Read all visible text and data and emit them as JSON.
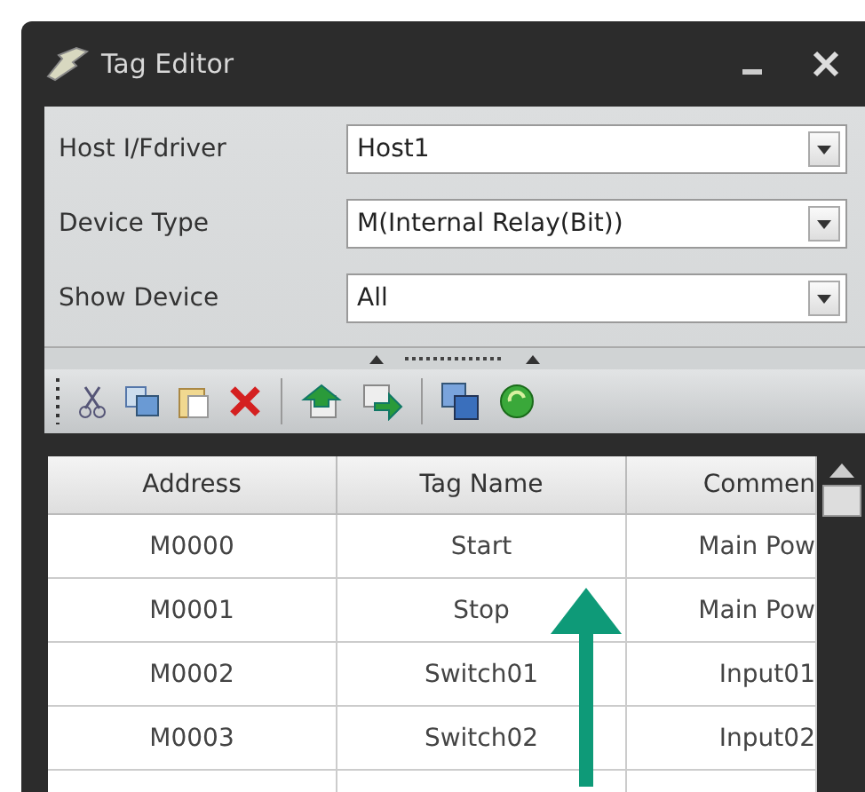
{
  "window": {
    "title": "Tag Editor"
  },
  "fields": [
    {
      "label": "Host I/Fdriver",
      "value": "Host1"
    },
    {
      "label": "Device Type",
      "value": "M(Internal Relay(Bit))"
    },
    {
      "label": "Show Device",
      "value": "All"
    }
  ],
  "table": {
    "columns": [
      "Address",
      "Tag Name",
      "Commen"
    ],
    "rows": [
      [
        "M0000",
        "Start",
        "Main Pow"
      ],
      [
        "M0001",
        "Stop",
        "Main Pow"
      ],
      [
        "M0002",
        "Switch01",
        "Input01"
      ],
      [
        "M0003",
        "Switch02",
        "Input02"
      ],
      [
        "",
        "",
        ""
      ]
    ]
  }
}
